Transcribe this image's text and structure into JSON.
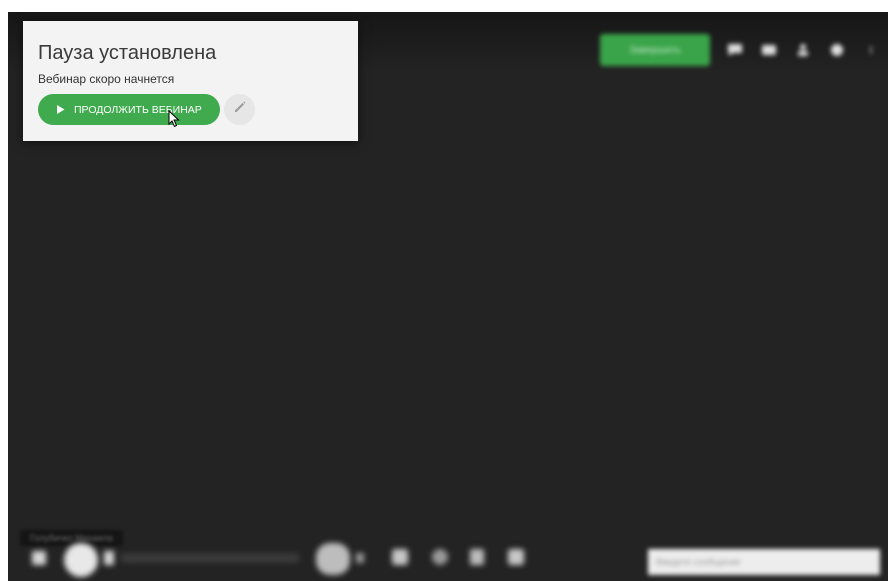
{
  "pause_card": {
    "title": "Пауза установлена",
    "subtitle": "Вебинар скоро начнется",
    "continue_label": "ПРОДОЛЖИТЬ ВЕБИНАР"
  },
  "topbar": {
    "action_label": "Завершить",
    "icons": [
      "chat-icon",
      "message-icon",
      "user-icon",
      "settings-icon",
      "close-icon"
    ]
  },
  "bottom": {
    "label": "Голубичко Михаила",
    "chat_placeholder": "Введите сообщение"
  },
  "colors": {
    "accent": "#3faa4e",
    "stage_bg": "#232323",
    "card_bg": "#f3f3f3"
  }
}
